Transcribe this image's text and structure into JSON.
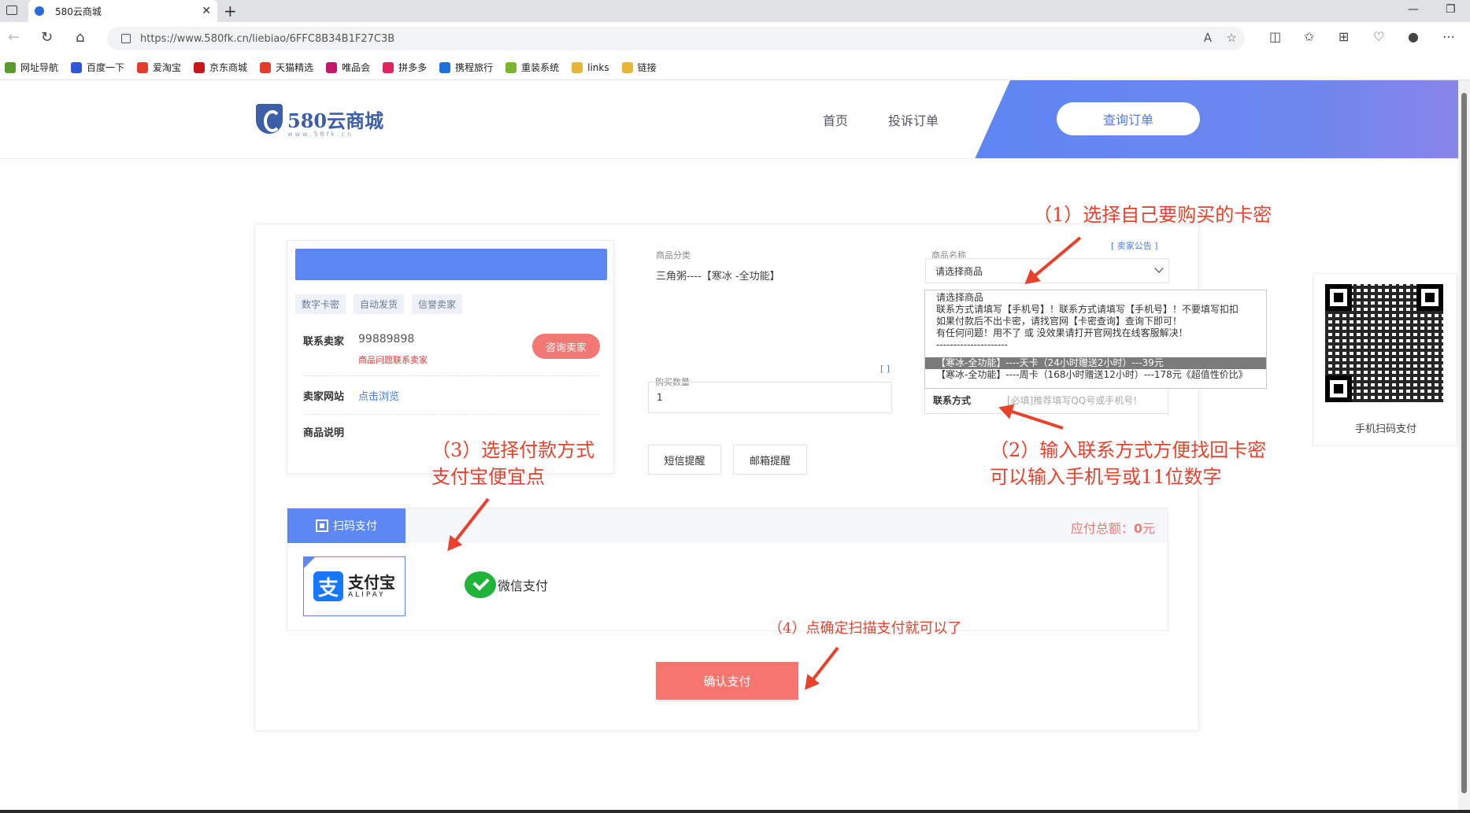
{
  "browser": {
    "tab_title": "580云商城",
    "url": "https://www.580fk.cn/liebiao/6FFC8B34B1F27C3B",
    "bookmarks": [
      "网址导航",
      "百度一下",
      "爱淘宝",
      "京东商城",
      "天猫精选",
      "唯品会",
      "拼多多",
      "携程旅行",
      "重装系统",
      "links",
      "链接"
    ],
    "bookmark_colors": [
      "#5a9a2e",
      "#3257d6",
      "#e23c2a",
      "#c8161d",
      "#e23c2a",
      "#c2186b",
      "#e0245e",
      "#1d72d8",
      "#7bb52d",
      "#e8b53b",
      "#e8b53b"
    ]
  },
  "header": {
    "logo_name": "580云商城",
    "logo_sub": "www.58fk.cn",
    "nav": [
      "首页",
      "投诉订单"
    ],
    "query_button": "查询订单"
  },
  "seller": {
    "tags": [
      "数字卡密",
      "自动发货",
      "信誉卖家"
    ],
    "contact_label": "联系卖家",
    "contact_qq": "99889898",
    "contact_note": "商品问题联系卖家",
    "consult_button": "咨询卖家",
    "website_label": "卖家网站",
    "website_link": "点击浏览",
    "desc_label": "商品说明"
  },
  "form": {
    "category_label": "商品分类",
    "category_value": "三角粥----【寒冰 -全功能】",
    "product_label": "商品名称",
    "notice_link": "[ 卖家公告 ]",
    "product_select": "请选择商品",
    "dropdown": [
      "请选择商品",
      "联系方式请填写【手机号】！联系方式请填写【手机号】！不要填写扣扣",
      "如果付款后不出卡密，请找官网【卡密查询】查询下即可！",
      "有任何问题！用不了 或 没效果请打开官网找在线客服解决！",
      "---------------------",
      "【寒冰-全功能】----天卡（24小时赠送2小时）---39元",
      "【寒冰-全功能】----周卡（168小时赠送12小时）---178元《超值性价比》"
    ],
    "dropdown_selected": 5,
    "qty_label": "购买数量",
    "qty_bracket": "[ ]",
    "qty_value": "1",
    "contact_label": "联系方式",
    "contact_placeholder": "[必填]推荐填写QQ号或手机号!",
    "sms_button": "短信提醒",
    "email_button": "邮箱提醒"
  },
  "payment": {
    "tab_label": "扫码支付",
    "total_label": "应付总额：",
    "total_value": "0",
    "total_unit": "元",
    "alipay_cn": "支付宝",
    "alipay_en": "ALIPAY",
    "wechat_label": "微信支付",
    "confirm_button": "确认支付"
  },
  "qr": {
    "label": "手机扫码支付"
  },
  "annotations": {
    "a1": "（1）选择自己要购买的卡密",
    "a2_line1": "（2）输入联系方式方便找回卡密",
    "a2_line2": "可以输入手机号或11位数字",
    "a3_line1": "（3）选择付款方式",
    "a3_line2": "支付宝便宜点",
    "a4": "（4）点确定扫描支付就可以了"
  }
}
